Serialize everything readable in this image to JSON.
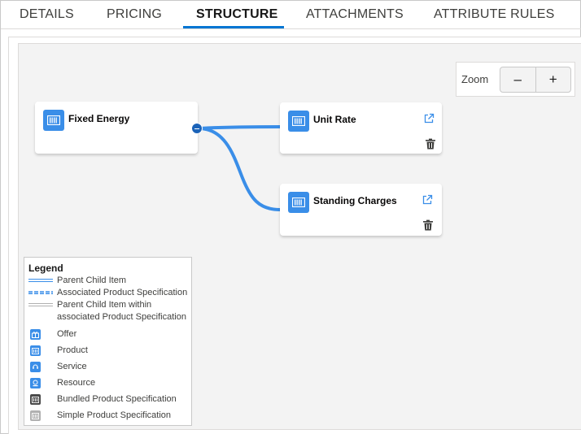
{
  "tabs": [
    {
      "label": "DETAILS"
    },
    {
      "label": "PRICING"
    },
    {
      "label": "STRUCTURE"
    },
    {
      "label": "ATTACHMENTS"
    },
    {
      "label": "ATTRIBUTE RULES"
    }
  ],
  "active_tab": "STRUCTURE",
  "nodes": {
    "root": {
      "title": "Fixed Energy",
      "icon": "product-icon"
    },
    "child1": {
      "title": "Unit Rate",
      "icon": "product-icon"
    },
    "child2": {
      "title": "Standing Charges",
      "icon": "product-icon"
    }
  },
  "zoom": {
    "label": "Zoom",
    "minus": "–",
    "plus": "+"
  },
  "legend": {
    "title": "Legend",
    "lines": [
      {
        "label": "Parent Child Item"
      },
      {
        "label": "Associated Product Specification"
      },
      {
        "label_1": "Parent Child Item within",
        "label_2": "associated Product Specification"
      }
    ],
    "items": [
      {
        "label": "Offer",
        "icon": "offer-icon"
      },
      {
        "label": "Product",
        "icon": "product-icon"
      },
      {
        "label": "Service",
        "icon": "service-icon"
      },
      {
        "label": "Resource",
        "icon": "resource-icon"
      },
      {
        "label": "Bundled Product Specification",
        "icon": "bundled-spec-icon"
      },
      {
        "label": "Simple Product Specification",
        "icon": "simple-spec-icon"
      }
    ]
  },
  "colors": {
    "accent": "#0176d3",
    "connector": "#3a8ee8",
    "icon_blue": "#3a8ee8",
    "bundled": "#4a4a4a",
    "simple": "#b0b0b0"
  }
}
